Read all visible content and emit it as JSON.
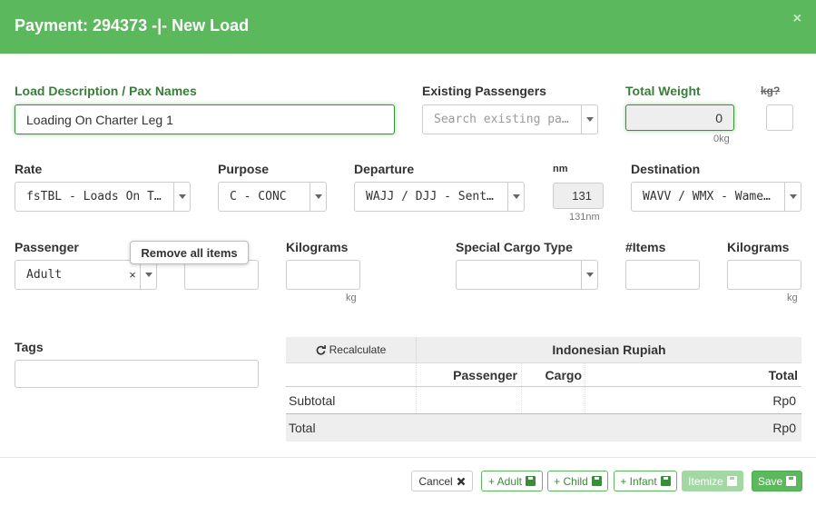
{
  "header": {
    "title": "Payment: 294373 -|- New Load",
    "close_glyph": "×"
  },
  "fields": {
    "load_description": {
      "label": "Load Description / Pax Names",
      "value": "Loading On Charter Leg 1"
    },
    "existing_passengers": {
      "label": "Existing Passengers",
      "placeholder": "Search existing pa…"
    },
    "total_weight": {
      "label": "Total Weight",
      "value": "0",
      "sub": "0kg"
    },
    "kg_toggle": {
      "label": "kg?"
    },
    "rate": {
      "label": "Rate",
      "value": "fsTBL - Loads On T…"
    },
    "purpose": {
      "label": "Purpose",
      "value": "C - CONC"
    },
    "departure": {
      "label": "Departure",
      "value": "WAJJ / DJJ - Sent…"
    },
    "nm": {
      "label": "nm",
      "value": "131",
      "sub": "131nm"
    },
    "destination": {
      "label": "Destination",
      "value": "WAVV / WMX - Wame…"
    },
    "passenger": {
      "label": "Passenger",
      "value": "Adult",
      "clear": "×"
    },
    "kilograms": {
      "label": "Kilograms",
      "unit": "kg"
    },
    "special_cargo": {
      "label": "Special Cargo Type"
    },
    "items": {
      "label": "#Items"
    },
    "kilograms2": {
      "label": "Kilograms",
      "unit": "kg"
    },
    "tags": {
      "label": "Tags"
    }
  },
  "tooltip": {
    "text": "Remove all items"
  },
  "pricing": {
    "recalculate": "Recalculate",
    "currency": "Indonesian Rupiah",
    "columns": [
      "Passenger",
      "Cargo",
      "Total"
    ],
    "subtotal": {
      "label": "Subtotal",
      "passenger": "",
      "cargo": "",
      "total": "Rp0"
    },
    "total": {
      "label": "Total",
      "value": "Rp0"
    }
  },
  "footer": {
    "cancel": "Cancel",
    "adult": "+ Adult",
    "child": "+ Child",
    "infant": "+ Infant",
    "itemize": "Itemize",
    "save": "Save"
  },
  "colors": {
    "header": "#5cb85c",
    "accent_text": "#3a7d3a"
  },
  "icons": [
    "close-icon",
    "chevron-down-icon",
    "clear-icon",
    "refresh-icon",
    "floppy-disk-icon",
    "x-icon"
  ]
}
